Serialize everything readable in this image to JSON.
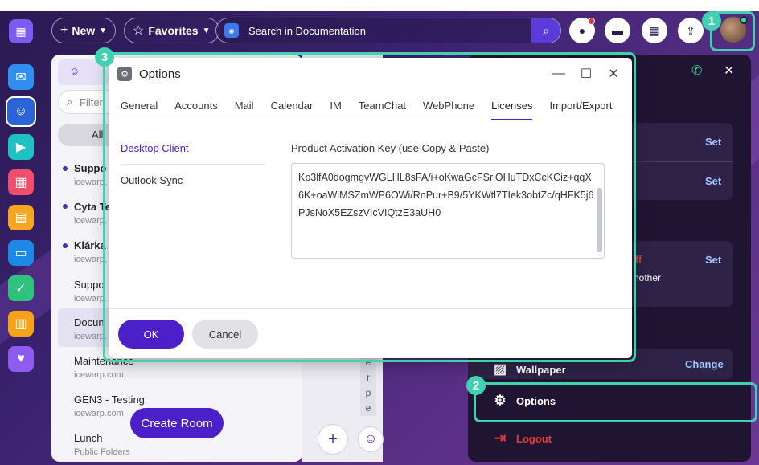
{
  "topbar": {
    "new_label": "New",
    "favorites_label": "Favorites",
    "search_placeholder": "Search in Documentation"
  },
  "list_panel": {
    "filter_placeholder": "Filter",
    "filter_tab": "All",
    "items": [
      {
        "title": "Suppo",
        "subtitle": "icewarp.",
        "unread": true
      },
      {
        "title": "Cyta Te",
        "subtitle": "icewarp.",
        "unread": true
      },
      {
        "title": "Klárka I",
        "subtitle": "icewarp.",
        "unread": true
      },
      {
        "title": "Suppo",
        "subtitle": "icewarp.",
        "unread": false
      },
      {
        "title": "Docun",
        "subtitle": "icewarp.",
        "unread": false
      },
      {
        "title": "Maintenance",
        "subtitle": "icewarp.com",
        "unread": false
      },
      {
        "title": "GEN3 - Testing",
        "subtitle": "icewarp.com",
        "unread": false
      },
      {
        "title": "Lunch",
        "subtitle": "Public Folders",
        "unread": false
      }
    ],
    "create_room_label": "Create Room"
  },
  "middle": {
    "letters": [
      "e",
      "r",
      "p",
      "e"
    ]
  },
  "right_panel": {
    "set_labels": [
      "Set",
      "Set",
      "Set"
    ],
    "off_label": "ff",
    "another_label": "nother",
    "wallpaper_label": "Wallpaper",
    "wallpaper_action": "Change",
    "options_label": "Options",
    "logout_label": "Logout"
  },
  "dialog": {
    "title": "Options",
    "tabs": [
      "General",
      "Accounts",
      "Mail",
      "Calendar",
      "IM",
      "TeamChat",
      "WebPhone",
      "Licenses",
      "Import/Export"
    ],
    "active_tab": "Licenses",
    "side_nav": [
      "Desktop Client",
      "Outlook Sync"
    ],
    "key_label": "Product Activation Key (use Copy & Paste)",
    "key_value": "Kp3lfA0dogmgvWGLHL8sFA/i+oKwaGcFSriOHuTDxCcKCiz+qqX6K+oaWiMSZmWP6OWi/RnPur+B9/5YKWtl7TIek3obtZc/qHFK5j6PJsNoX5EZszVIcVIQtzE3aUH0",
    "ok_label": "OK",
    "cancel_label": "Cancel"
  },
  "annotations": [
    "1",
    "2",
    "3"
  ],
  "colors": {
    "accent": "#4b20c9",
    "highlight": "#3fd1b0",
    "link": "#9fc4ff",
    "logout": "#e53935"
  }
}
